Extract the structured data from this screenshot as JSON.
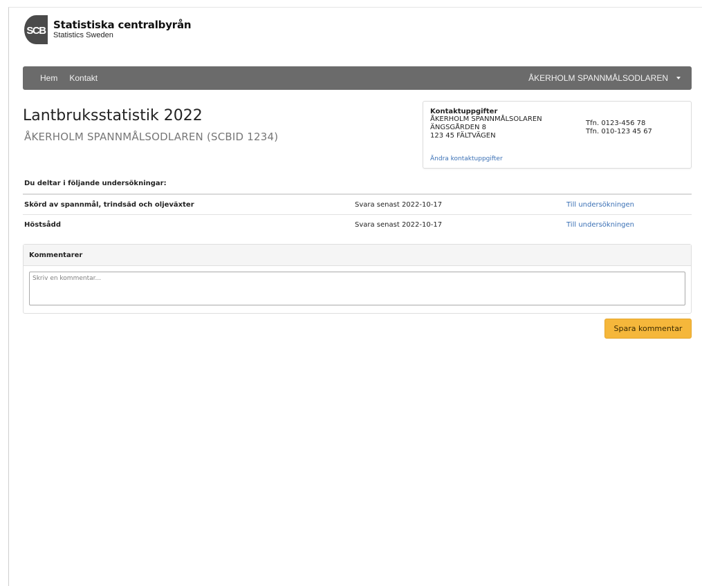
{
  "logo": {
    "mark_text": "SCB",
    "title": "Statistiska centralbyrån",
    "subtitle": "Statistics Sweden"
  },
  "nav": {
    "home_label": "Hem",
    "contact_label": "Kontakt",
    "user_label": "ÅKERHOLM SPANNMÅLSODLAREN",
    "bg_color": "#6b6b6b"
  },
  "header": {
    "title": "Lantbruksstatistik 2022",
    "subtitle": "ÅKERHOLM SPANNMÅLSODLAREN (SCBID 1234)"
  },
  "contact": {
    "title": "Kontaktuppgifter",
    "name": "ÅKERHOLM SPANNMÅLSOLAREN",
    "street": "ÄNGSGÅRDEN 8",
    "postal": "123 45 FÄLTVÄGEN",
    "phone1": "Tfn. 0123-456 78",
    "phone2": "Tfn. 010-123 45 67",
    "edit_link": "Ändra kontaktuppgifter"
  },
  "surveys": {
    "heading": "Du deltar i följande undersökningar:",
    "rows": [
      {
        "name": "Skörd av spannmål, trindsäd och oljeväxter",
        "due": "Svara senast 2022-10-17",
        "link": "Till undersökningen"
      },
      {
        "name": "Höstsådd",
        "due": "Svara senast 2022-10-17",
        "link": "Till undersökningen"
      }
    ]
  },
  "comments": {
    "header": "Kommentarer",
    "placeholder": "Skriv en kommentar...",
    "save_label": "Spara kommentar",
    "save_color": "#f5b73b"
  }
}
